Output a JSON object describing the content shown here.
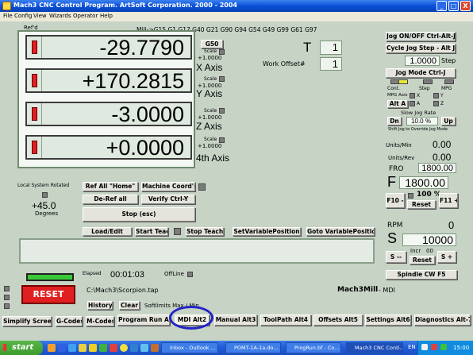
{
  "window": {
    "title": "Mach3 CNC Control Program.  ArtSoft Corporation. 2000 - 2004",
    "min": "_",
    "max": "□",
    "close": "X"
  },
  "menu": [
    "File",
    "Config",
    "View",
    "Wizards",
    "Operator",
    "Help"
  ],
  "top": {
    "refd_label": "Ref'd",
    "mill_gcodes": "Mill->G15  G1 G17 G40 G21 G90 G94 G54 G49 G99 G61 G97"
  },
  "dro": [
    {
      "value": "-29.7790",
      "axis": "X Axis",
      "scale_label": "Scale",
      "scale": "+1.0000"
    },
    {
      "value": "+170.2815",
      "axis": "Y Axis",
      "scale_label": "Scale",
      "scale": "+1.0000"
    },
    {
      "value": "-3.0000",
      "axis": "Z Axis",
      "scale_label": "Scale",
      "scale": "+1.0000"
    },
    {
      "value": "+0.0000",
      "axis": "4th Axis",
      "scale_label": "Scale",
      "scale": "+1.0000"
    }
  ],
  "g50": "G50",
  "tool": {
    "label": "T",
    "value": "1",
    "offset_label": "Work Offset#",
    "offset_value": "1"
  },
  "jog": {
    "onoff": "Jog ON/OFF Ctrl-Alt-J",
    "cycle": "Cycle Jog Step - Alt J",
    "step_value": "1.0000",
    "step_label": "Step",
    "mode": "Jog Mode Ctrl-J",
    "cont": "Cont.",
    "step": "Step",
    "mpg": "MPG",
    "mpg_axis": "MPG Axis",
    "x": "X",
    "y": "Y",
    "z": "Z",
    "a": "A",
    "alt_a": "Alt A",
    "slow_rate": "Slow Jog Rate",
    "dn": "Dn",
    "rate": "10.0 %",
    "up": "Up",
    "shift_note": "Shift Jog to Override Jog Mode"
  },
  "feed": {
    "units_min_label": "Units/Min",
    "units_min": "0.00",
    "units_rev_label": "Units/Rev",
    "units_rev": "0.00",
    "fro_label": "FRO",
    "fro": "1800.00",
    "f_label": "F",
    "f_value": "1800.00",
    "f10_minus": "F10 -",
    "pct": "100 %",
    "f11_plus": "F11 +",
    "reset": "Reset"
  },
  "spindle": {
    "rpm_label": "RPM",
    "rpm": "0",
    "s_label": "S",
    "s_value": "10000",
    "s_minus": "S --",
    "incr": "Incr",
    "incr_value": "00",
    "reset": "Reset",
    "s_plus": "S +",
    "cw": "Spindle CW F5"
  },
  "left": {
    "local_rotated": "Local System Rotated",
    "degrees_value": "+45.0",
    "degrees_label": "Degrees"
  },
  "buttons": {
    "ref_all": "Ref All \"Home\"",
    "machine_coords": "Machine Coord's",
    "deref_all": "De-Ref all",
    "verify": "Verify Ctrl-Y",
    "stop": "Stop (esc)",
    "load_edit": "Load/Edit",
    "start_teach": "Start Teach",
    "stop_teach": "Stop Teach",
    "set_variable": "SetVariablePosition",
    "goto_variable": "Goto VariablePosition",
    "history": "History",
    "clear": "Clear",
    "softlimits": "Softlimits Max / Min",
    "reset": "RESET"
  },
  "status": {
    "elapsed_label": "Elapsed",
    "elapsed": "00:01:03",
    "offline_label": "OffLine",
    "file": "C:\\Mach3\\Scorpion.tap",
    "profile": "Mach3Mill",
    "mode": "- MDI"
  },
  "tabs": [
    "Simplify Screen",
    "G-Codes",
    "M-Codes",
    "Program Run Alt-1",
    "MDI Alt2",
    "Manual Alt3",
    "ToolPath Alt4",
    "Offsets Alt5",
    "Settings Alt6",
    "Diagnostics Alt-7"
  ],
  "taskbar": {
    "start": "start",
    "tasks": [
      "Inbox - Outlook ...",
      "POMT-1A-1a.do...",
      "ProgRun.bf - Co...",
      "Mach3 CNC Conti..."
    ],
    "lang": "EN",
    "clock": "15:00"
  }
}
